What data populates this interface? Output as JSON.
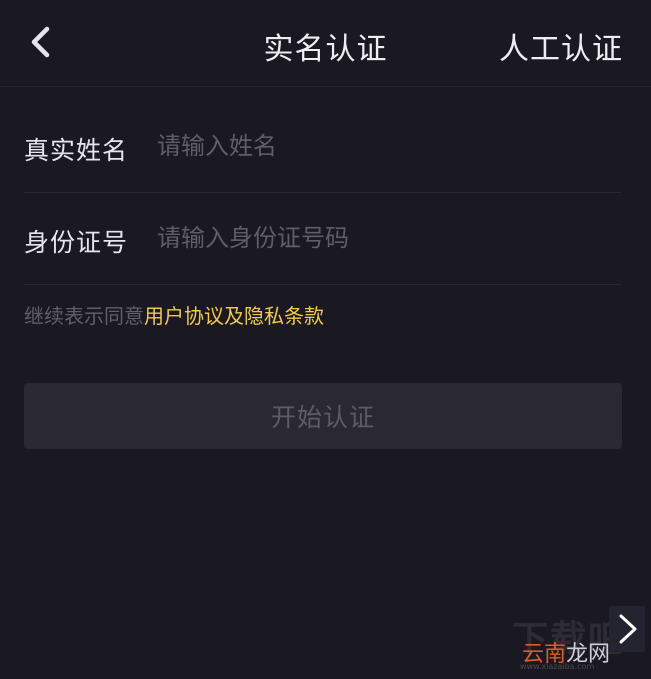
{
  "nav": {
    "title": "实名认证",
    "right_action": "人工认证",
    "back_icon": "chevron-left-icon"
  },
  "form": {
    "name": {
      "label": "真实姓名",
      "placeholder": "请输入姓名",
      "value": ""
    },
    "id_number": {
      "label": "身份证号",
      "placeholder": "请输入身份证号码",
      "value": ""
    }
  },
  "agreement": {
    "prefix": "继续表示同意",
    "link": "用户协议及隐私条款"
  },
  "submit": {
    "label": "开始认证"
  },
  "watermark": {
    "background_text": "下载吧",
    "brand_part1": "云南",
    "brand_part2": "龙网",
    "domain": "www.xiazaiba.com"
  },
  "overlay": {
    "next_icon": "chevron-right-icon"
  },
  "colors": {
    "background": "#1a1922",
    "accent_link": "#f3c94a",
    "button_bg": "#2a2932",
    "button_text": "#5d5c66",
    "watermark_orange": "#e05a26"
  }
}
